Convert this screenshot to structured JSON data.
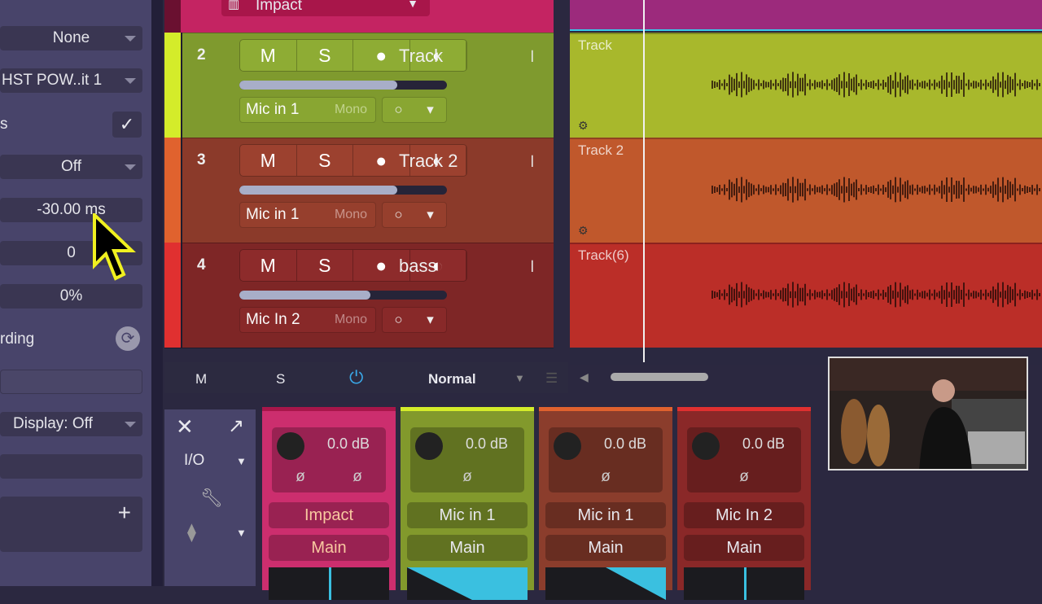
{
  "inspector": {
    "fields": [
      {
        "value": "None",
        "dropdown": true
      },
      {
        "value": "HST POW..it 1",
        "dropdown": true
      },
      {
        "label": "s",
        "checked": true
      },
      {
        "value": "Off",
        "dropdown": true
      },
      {
        "value": "-30.00 ms"
      },
      {
        "value": "0"
      },
      {
        "value": "0%"
      },
      {
        "label": "rding"
      },
      {
        "value": "Display: Off",
        "dropdown": true
      }
    ],
    "add_label": "+"
  },
  "top_instrument": {
    "name": "Impact"
  },
  "tracks": [
    {
      "number": "2",
      "name": "Track",
      "input": "Mic in 1",
      "mode": "Mono",
      "fader": 0.76,
      "color": "#7f9a2e",
      "strip": "#d4ec2a",
      "lane": "#a8b82c",
      "lane_name": "Track"
    },
    {
      "number": "3",
      "name": "Track 2",
      "input": "Mic in 1",
      "mode": "Mono",
      "fader": 0.76,
      "color": "#8b3a2a",
      "strip": "#e0622e",
      "lane": "#c0582c",
      "lane_name": "Track 2"
    },
    {
      "number": "4",
      "name": "bass",
      "input": "Mic In 2",
      "mode": "Mono",
      "fader": 0.63,
      "color": "#7e2626",
      "strip": "#e03030",
      "lane": "#bb2e28",
      "lane_name": "Track(6)"
    }
  ],
  "track_buttons": {
    "mute": "M",
    "solo": "S"
  },
  "bottom_bar": {
    "mute": "M",
    "solo": "S",
    "mode": "Normal"
  },
  "mixer": {
    "io_label": "I/O",
    "strips": [
      {
        "gain": "0.0 dB",
        "input": "Impact",
        "output": "Main",
        "color": "#cc2e6e",
        "top": "#a8164a",
        "phase_count": 2
      },
      {
        "gain": "0.0 dB",
        "input": "Mic in 1",
        "output": "Main",
        "color": "#82992c",
        "top": "#d4ec2a",
        "phase_count": 1
      },
      {
        "gain": "0.0 dB",
        "input": "Mic in 1",
        "output": "Main",
        "color": "#8b3d2c",
        "top": "#e0622e",
        "phase_count": 1
      },
      {
        "gain": "0.0 dB",
        "input": "Mic In 2",
        "output": "Main",
        "color": "#8a2828",
        "top": "#e03030",
        "phase_count": 1
      }
    ]
  },
  "colors": {
    "accent": "#3aa8e8",
    "cursor": "#f0f020"
  }
}
